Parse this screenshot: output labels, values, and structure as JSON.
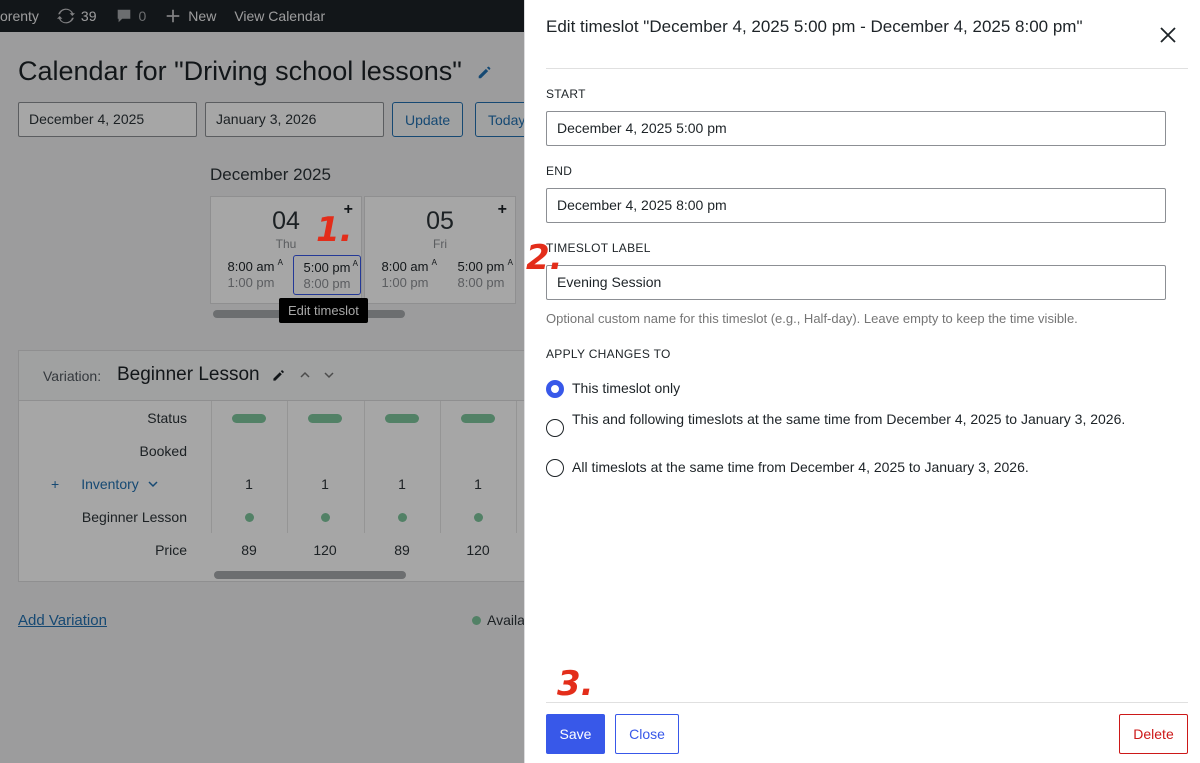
{
  "adminbar": {
    "site_fragment": "orenty",
    "updates_count": "39",
    "comments_count": "0",
    "new_label": "New",
    "view_label": "View Calendar"
  },
  "page": {
    "title": "Calendar for \"Driving school lessons\"",
    "start_date": "December 4, 2025",
    "end_date": "January 3, 2026",
    "update_label": "Update",
    "today_label": "Today",
    "month": "December 2025",
    "days": [
      {
        "num": "04",
        "weekday": "Thu",
        "slots": [
          {
            "start": "8:00 am",
            "end": "1:00 pm",
            "flag": "A"
          },
          {
            "start": "5:00 pm",
            "end": "8:00 pm",
            "flag": "A"
          }
        ]
      },
      {
        "num": "05",
        "weekday": "Fri",
        "slots": [
          {
            "start": "8:00 am",
            "end": "1:00 pm",
            "flag": "A"
          },
          {
            "start": "5:00 pm",
            "end": "8:00 pm",
            "flag": "A"
          }
        ]
      }
    ],
    "tooltip": "Edit timeslot",
    "variation": {
      "label": "Variation:",
      "name": "Beginner Lesson",
      "rows": {
        "status": "Status",
        "booked": "Booked",
        "inventory": "Inventory",
        "variation_row": "Beginner Lesson",
        "price": "Price"
      },
      "inventory_values": [
        "1",
        "1",
        "1",
        "1"
      ],
      "price_values": [
        "89",
        "120",
        "89",
        "120"
      ]
    },
    "add_variation": "Add Variation",
    "legend_available": "Availa"
  },
  "annotations": {
    "step1": "1.",
    "step2": "2.",
    "step3": "3."
  },
  "drawer": {
    "title": "Edit timeslot \"December 4, 2025 5:00 pm - December 4, 2025 8:00 pm\"",
    "start_label": "START",
    "start_value": "December 4, 2025 5:00 pm",
    "end_label": "END",
    "end_value": "December 4, 2025 8:00 pm",
    "timeslot_label_label": "TIMESLOT LABEL",
    "timeslot_label_value": "Evening Session",
    "help": "Optional custom name for this timeslot (e.g., Half-day). Leave empty to keep the time visible.",
    "apply_label": "APPLY CHANGES TO",
    "options": [
      "This timeslot only",
      "This and following timeslots at the same time from December 4, 2025 to January 3, 2026.",
      "All timeslots at the same time from December 4, 2025 to January 3, 2026."
    ],
    "selected_option": 0,
    "save_label": "Save",
    "close_label": "Close",
    "delete_label": "Delete"
  },
  "colors": {
    "primary": "#3858e9",
    "danger": "#cc1818",
    "annotation": "#e32d1a",
    "available": "#7fc69d"
  }
}
